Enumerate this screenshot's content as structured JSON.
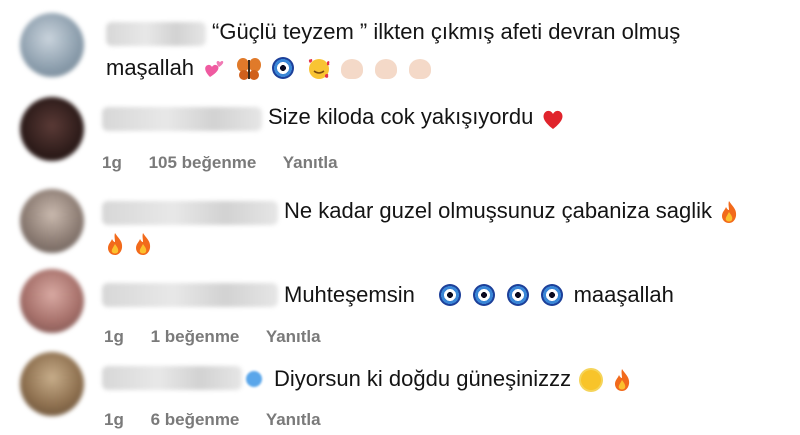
{
  "comments": [
    {
      "text_line1": "“Güçlü teyzem ” ilkten çıkmış afeti devran olmuş",
      "text_line2": "maşallah"
    },
    {
      "text": "Size kiloda cok yakışıyordu",
      "time": "1g",
      "likes": "105 beğenme",
      "reply": "Yanıtla"
    },
    {
      "text": "Ne kadar guzel olmuşsunuz çabaniza saglik"
    },
    {
      "text_pre": "Muhteşemsin",
      "text_post": "maaşallah",
      "time": "1g",
      "likes": "1 beğenme",
      "reply": "Yanıtla"
    },
    {
      "text": "Diyorsun ki doğdu güneşinizzz",
      "time": "1g",
      "likes": "6 beğenme",
      "reply": "Yanıtla"
    }
  ],
  "colors": {
    "meta": "#7a7a7a",
    "heart": "#e0242c",
    "fire": "#f26a1b",
    "evil_eye": "#1c3f99"
  },
  "icons": [
    "two-hearts-icon",
    "butterfly-icon",
    "evil-eye-icon",
    "smiling-face-hearts-icon",
    "clapping-hands-icon",
    "red-heart-icon",
    "fire-icon",
    "sun-icon",
    "verified-badge-icon"
  ]
}
